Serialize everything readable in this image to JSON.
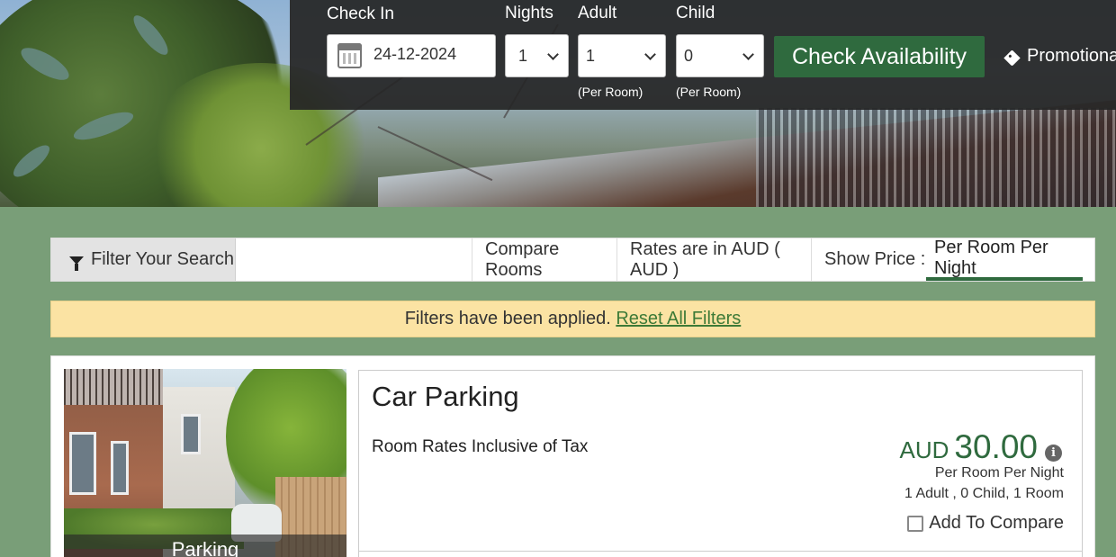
{
  "booking": {
    "check_in_label": "Check In",
    "check_in_value": "24-12-2024",
    "nights_label": "Nights",
    "nights_value": "1",
    "adult_label": "Adult",
    "adult_value": "1",
    "adult_sub": "(Per Room)",
    "child_label": "Child",
    "child_value": "0",
    "child_sub": "(Per Room)",
    "check_button": "Check Availability",
    "promo_label": "Promotional"
  },
  "filterbar": {
    "filter_label": "Filter Your Search",
    "compare_label": "Compare Rooms",
    "rates_label": "Rates are in AUD ( AUD )",
    "show_price_label": "Show Price :",
    "per_option": "Per Room Per Night"
  },
  "notice": {
    "text": "Filters have been applied.",
    "link": "Reset All Filters"
  },
  "room": {
    "photo_caption": "Parking",
    "title": "Car Parking",
    "tax_note": "Room Rates Inclusive of Tax",
    "currency": "AUD",
    "amount": "30.00",
    "info_glyph": "i",
    "per_text": "Per Room Per Night",
    "occupancy": "1 Adult , 0 Child, 1 Room",
    "compare_label": "Add To Compare"
  },
  "colors": {
    "accent_green": "#2f6a3e",
    "page_bg": "#799e78",
    "notice_bg": "#fbe3a3",
    "booking_bar_bg": "#262626"
  },
  "icons": [
    "calendar-icon",
    "chevron-down-icon",
    "tag-icon",
    "filter-icon",
    "info-icon",
    "checkbox-icon"
  ]
}
